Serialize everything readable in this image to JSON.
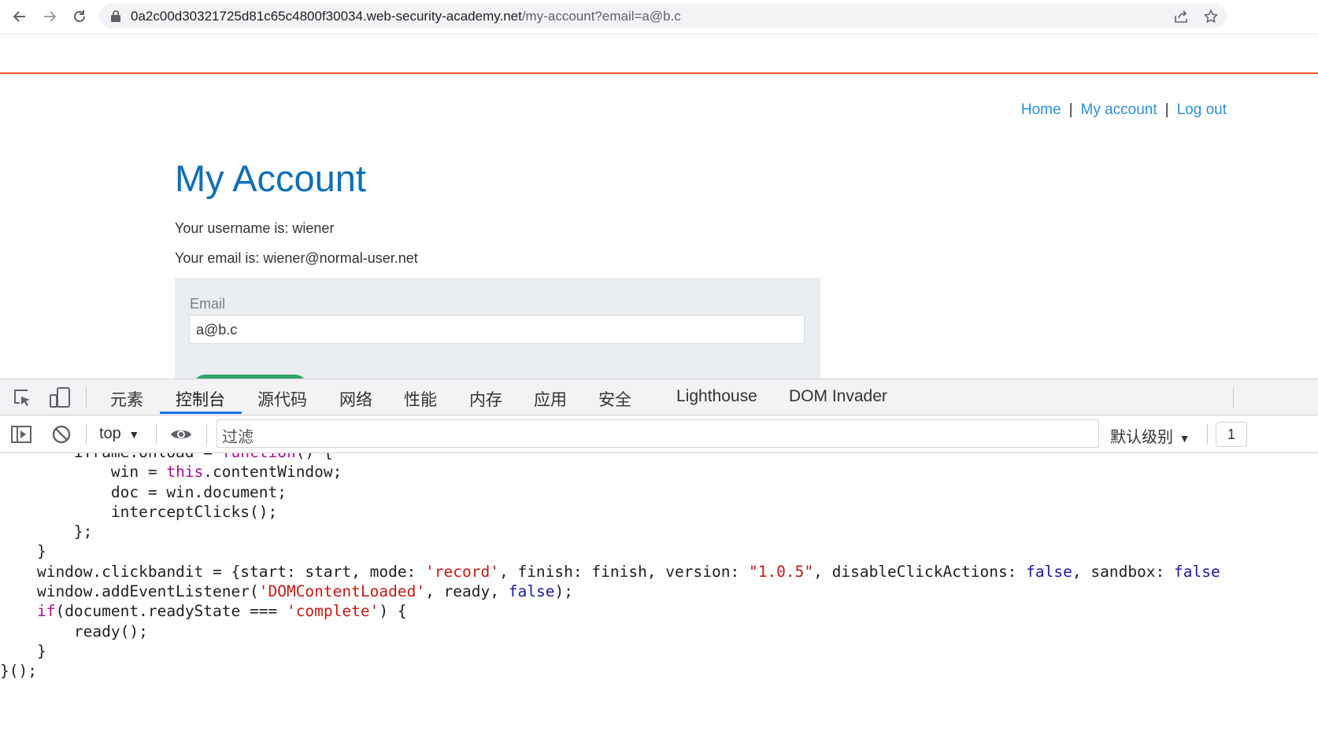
{
  "browser": {
    "url_host": "0a2c00d30321725d81c65c4800f30034.web-security-academy.net",
    "url_path": "/my-account?email=a@b.c",
    "icons": [
      "back-arrow-icon",
      "forward-arrow-icon",
      "reload-icon",
      "lock-icon",
      "share-icon",
      "star-icon"
    ]
  },
  "site_nav": {
    "home": "Home",
    "separator": "|",
    "my_account": "My account",
    "log_out": "Log out"
  },
  "page": {
    "title": "My Account",
    "username_text": "Your username is: wiener",
    "email_text": "Your email is: wiener@normal-user.net",
    "form": {
      "email_label": "Email",
      "email_value": "a@b.c"
    },
    "colors": {
      "accent_line": "#f05a28",
      "heading": "#0f6fb8",
      "link": "#2b8fd6",
      "button": "#2ea56c"
    }
  },
  "devtools": {
    "tabs": [
      "元素",
      "控制台",
      "源代码",
      "网络",
      "性能",
      "内存",
      "应用",
      "安全",
      "Lighthouse",
      "DOM Invader"
    ],
    "active_tab": "控制台",
    "context": "top",
    "filter_placeholder": "过滤",
    "level": "默认级别",
    "badge": "1",
    "code_lines": [
      "        iframe.onload = function() {",
      "            win = this.contentWindow;",
      "            doc = win.document;",
      "            interceptClicks();",
      "        };",
      "    }",
      "    window.clickbandit = {start: start, mode: 'record', finish: finish, version: \"1.0.5\", disableClickActions: false, sandbox: false",
      "    window.addEventListener('DOMContentLoaded', ready, false);",
      "    if(document.readyState === 'complete') {",
      "        ready();",
      "    }",
      "}();"
    ]
  }
}
